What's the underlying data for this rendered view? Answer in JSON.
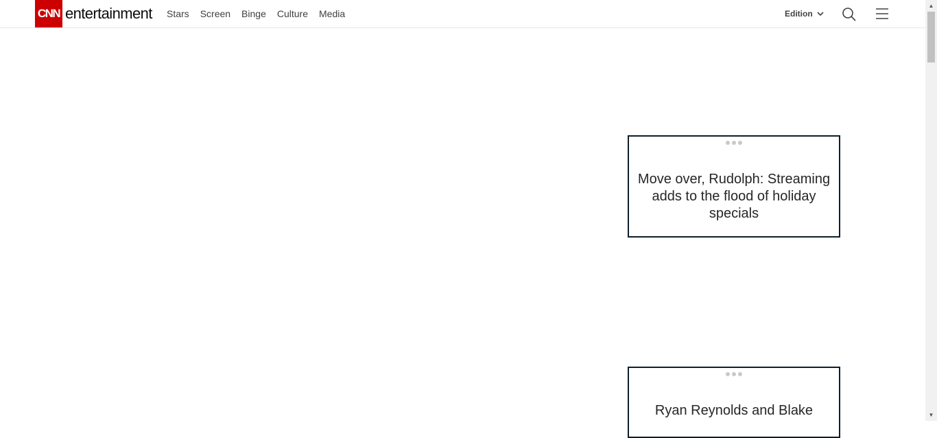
{
  "header": {
    "logo_mark": "CNN",
    "logo_word": "entertainment",
    "nav": [
      "Stars",
      "Screen",
      "Binge",
      "Culture",
      "Media"
    ],
    "edition_label": "Edition",
    "icons": {
      "search": "search-icon",
      "menu": "hamburger-menu-icon",
      "edition_chevron": "chevron-down-icon"
    }
  },
  "cards": [
    {
      "title": "Move over, Rudolph: Streaming adds to the flood of holiday specials"
    },
    {
      "title": "Ryan Reynolds and Blake"
    }
  ],
  "colors": {
    "brand_red": "#cc0000",
    "card_border": "#0e1e2a"
  }
}
